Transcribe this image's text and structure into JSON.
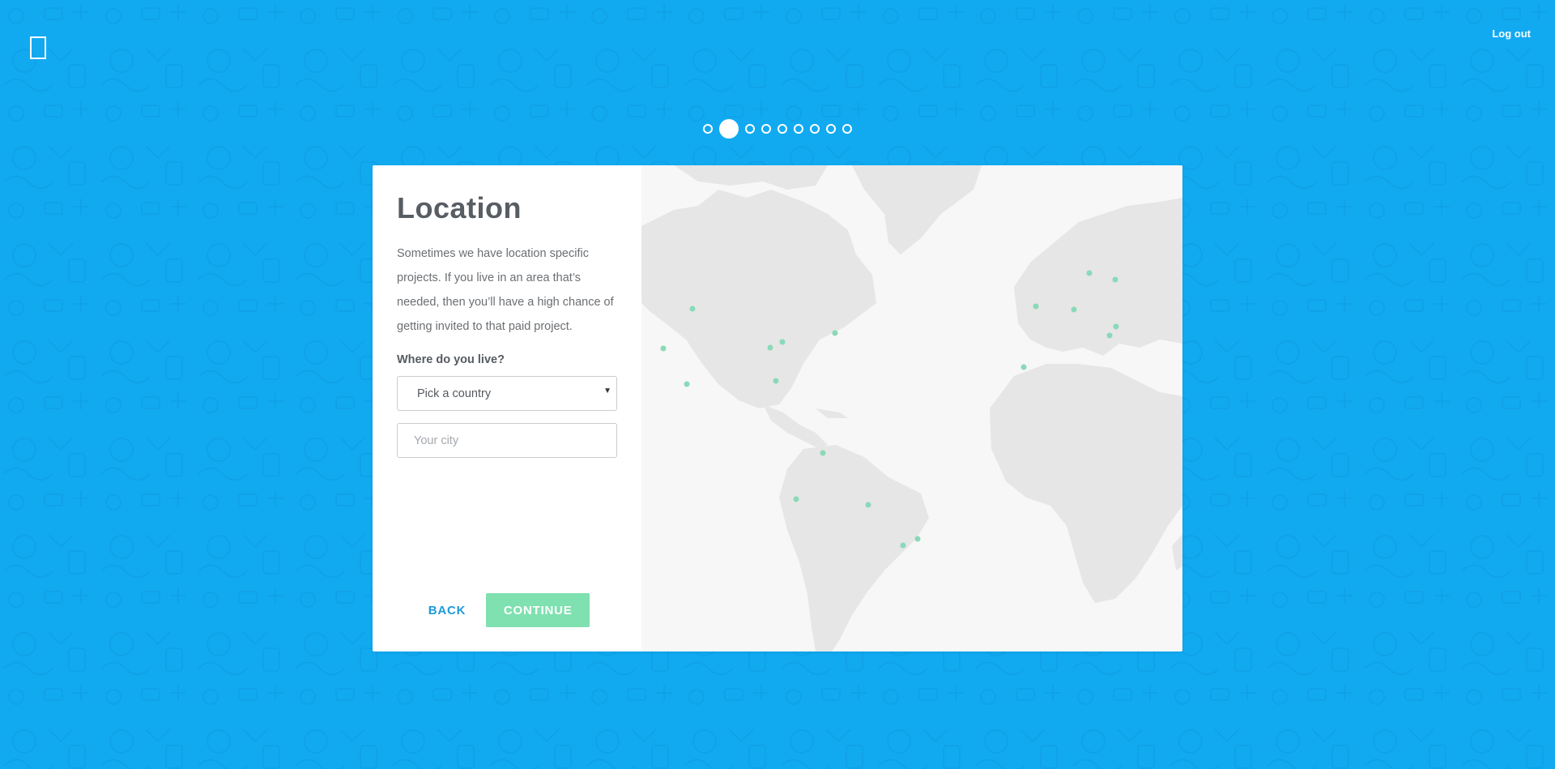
{
  "header": {
    "logout_label": "Log out"
  },
  "progress": {
    "total_steps": 9,
    "current_step": 2
  },
  "form": {
    "title": "Location",
    "description": "Sometimes we have location specific projects. If you live in an area that’s needed, then you’ll have a high chance of getting invited to that paid project.",
    "question": "Where do you live?",
    "country_select": {
      "selected": "Pick a country",
      "arrow_icon": "triangle-down-icon"
    },
    "city_input": {
      "placeholder": "Your city",
      "value": ""
    },
    "back_label": "BACK",
    "continue_label": "CONTINUE"
  },
  "colors": {
    "background": "#11aaf1",
    "accent_green": "#7fe0b0",
    "link_blue": "#1f9ad8",
    "map_land": "#e6e6e6",
    "map_marker": "#8ad9b9"
  },
  "icons": {
    "logo": "logo-outline-icon"
  }
}
